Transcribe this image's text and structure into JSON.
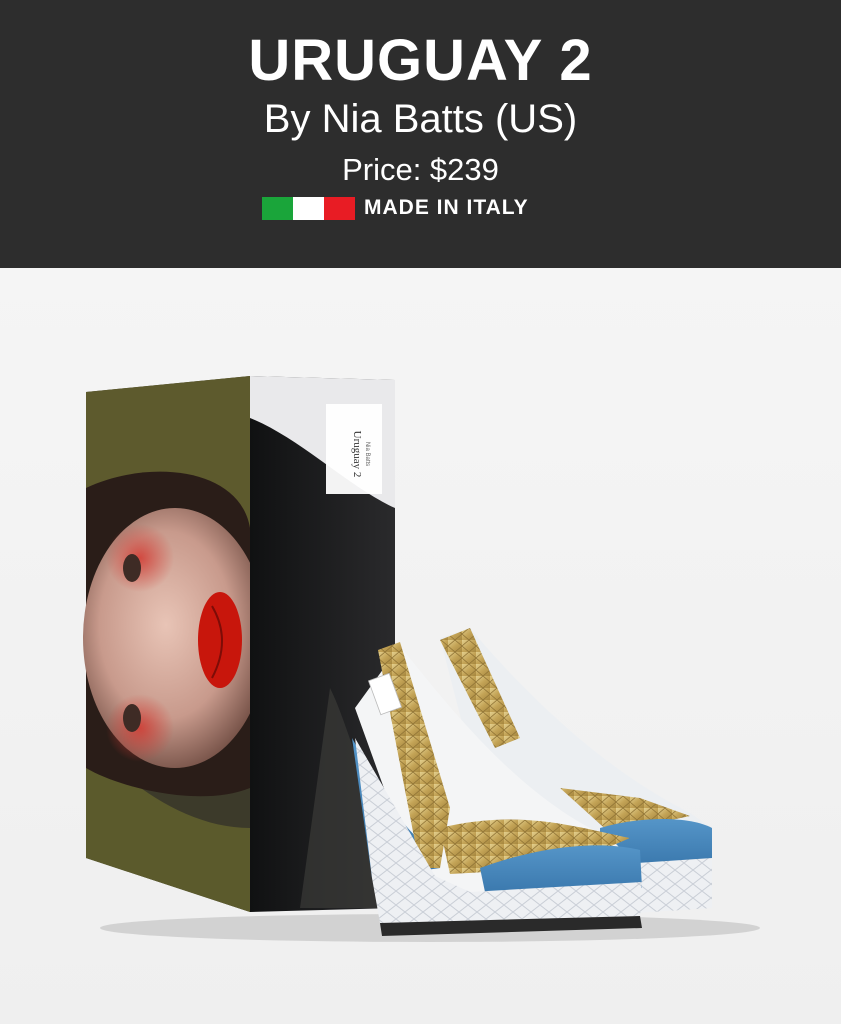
{
  "header": {
    "title": "URUGUAY 2",
    "byline": "By Nia Batts (US)",
    "price": "Price: $239",
    "made_in": "MADE IN ITALY",
    "flag_colors": [
      "#1aa53a",
      "#ffffff",
      "#e81c24"
    ]
  },
  "product": {
    "box_label": {
      "name": "Uruguay 2",
      "subtitle": "Nia Batts"
    },
    "colors": {
      "shoe_blue": "#4a88bd",
      "shoe_gold": "#c9ac5c",
      "sole_white": "#eceff2",
      "box_dark": "#1b1c1d",
      "lips": "#c8160c"
    }
  }
}
